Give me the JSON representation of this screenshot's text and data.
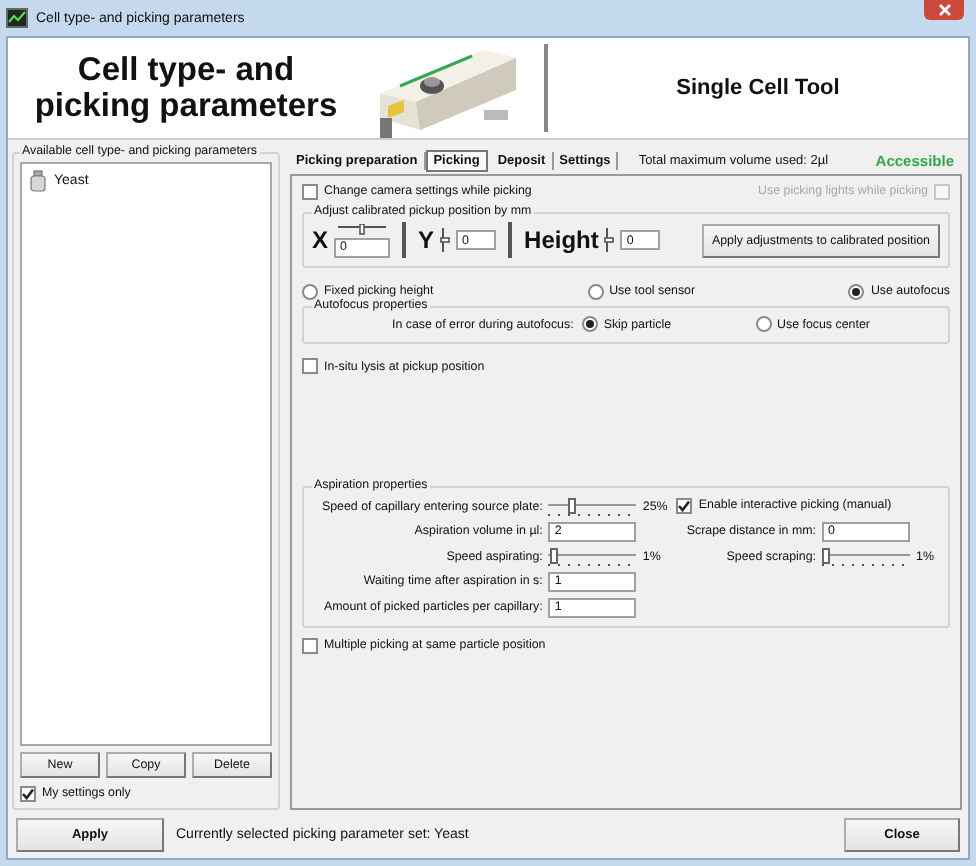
{
  "window": {
    "title": "Cell type- and picking parameters"
  },
  "header": {
    "title": "Cell type- and picking parameters",
    "product": "Single Cell Tool"
  },
  "sidebar": {
    "legend": "Available cell type- and picking parameters",
    "items": [
      {
        "label": "Yeast",
        "selected": false
      }
    ],
    "buttons": [
      "New",
      "Copy",
      "Delete"
    ],
    "my_settings_only": {
      "label": "My settings only",
      "checked": true
    }
  },
  "tabs": [
    {
      "label": "Picking preparation",
      "selected": false
    },
    {
      "label": "Picking",
      "selected": true
    },
    {
      "label": "Deposit",
      "selected": false
    },
    {
      "label": "Settings",
      "selected": false
    }
  ],
  "volume_info": "Total maximum volume used: 2µl",
  "status": "Accessible",
  "picking": {
    "camera_settings": {
      "label": "Change camera settings while picking",
      "checked": false
    },
    "picking_lights": {
      "label": "Use picking lights while picking",
      "checked": false,
      "disabled": true
    },
    "adjust": {
      "legend": "Adjust calibrated pickup position by mm",
      "axes": [
        {
          "label": "X",
          "value": "0",
          "level": 0.5
        },
        {
          "label": "Y",
          "value": "0",
          "level": 0.5
        },
        {
          "label": "Height",
          "value": "0",
          "level": 0.5
        }
      ],
      "button": "Apply adjustments to calibrated position"
    },
    "height_mode": [
      {
        "label": "Fixed picking height",
        "selected": false
      },
      {
        "label": "Use tool sensor",
        "selected": false
      },
      {
        "label": "Use autofocus",
        "selected": true
      }
    ],
    "autofocus": {
      "legend": "Autofocus properties",
      "prompt": "In case of error during autofocus:",
      "options": [
        {
          "label": "Skip particle",
          "selected": true
        },
        {
          "label": "Use focus center",
          "selected": false
        }
      ]
    },
    "in_situ_lysis": {
      "label": "In-situ lysis at pickup position",
      "checked": false
    },
    "aspiration": {
      "legend": "Aspiration properties",
      "entry_speed": {
        "label": "Speed of capillary entering source plate:",
        "level": 0.25,
        "reading": "25%"
      },
      "interactive": {
        "label": "Enable interactive picking (manual)",
        "checked": true
      },
      "volume": {
        "label": "Aspiration volume in µl:",
        "value": "2"
      },
      "scrape": {
        "label": "Scrape distance in mm:",
        "value": "0"
      },
      "speed_aspirating": {
        "label": "Speed aspirating:",
        "level": 0.01,
        "reading": "1%"
      },
      "speed_scraping": {
        "label": "Speed scraping:",
        "level": 0.01,
        "reading": "1%"
      },
      "wait": {
        "label": "Waiting time after aspiration in s:",
        "value": "1"
      },
      "particles": {
        "label": "Amount of picked particles per capillary:",
        "value": "1"
      }
    },
    "multiple_picking": {
      "label": "Multiple picking at same particle position",
      "checked": false
    }
  },
  "footer": {
    "apply": "Apply",
    "message": "Currently selected picking parameter set: Yeast",
    "close": "Close"
  }
}
